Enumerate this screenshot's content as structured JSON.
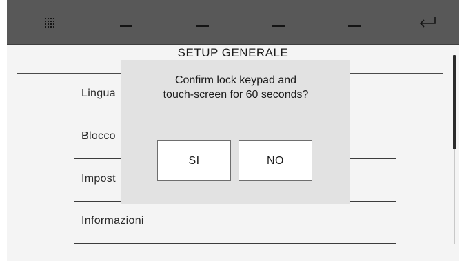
{
  "topbar": {
    "icons": [
      "grid-icon",
      "dash-icon",
      "dash-icon",
      "dash-icon",
      "dash-icon",
      "return-arrow-icon"
    ]
  },
  "page": {
    "title": "SETUP GENERALE"
  },
  "menu": {
    "items": [
      {
        "label": "Lingua"
      },
      {
        "label": "Blocco"
      },
      {
        "label": "Impost"
      },
      {
        "label": "Informazioni"
      }
    ]
  },
  "dialog": {
    "message_line1": "Confirm lock keypad and",
    "message_line2": "touch-screen for 60 seconds?",
    "yes_label": "SI",
    "no_label": "NO"
  },
  "colors": {
    "topbar": "#585858",
    "background": "#f4f4f4",
    "dialog": "#e2e2e2",
    "icon": "#141414"
  }
}
